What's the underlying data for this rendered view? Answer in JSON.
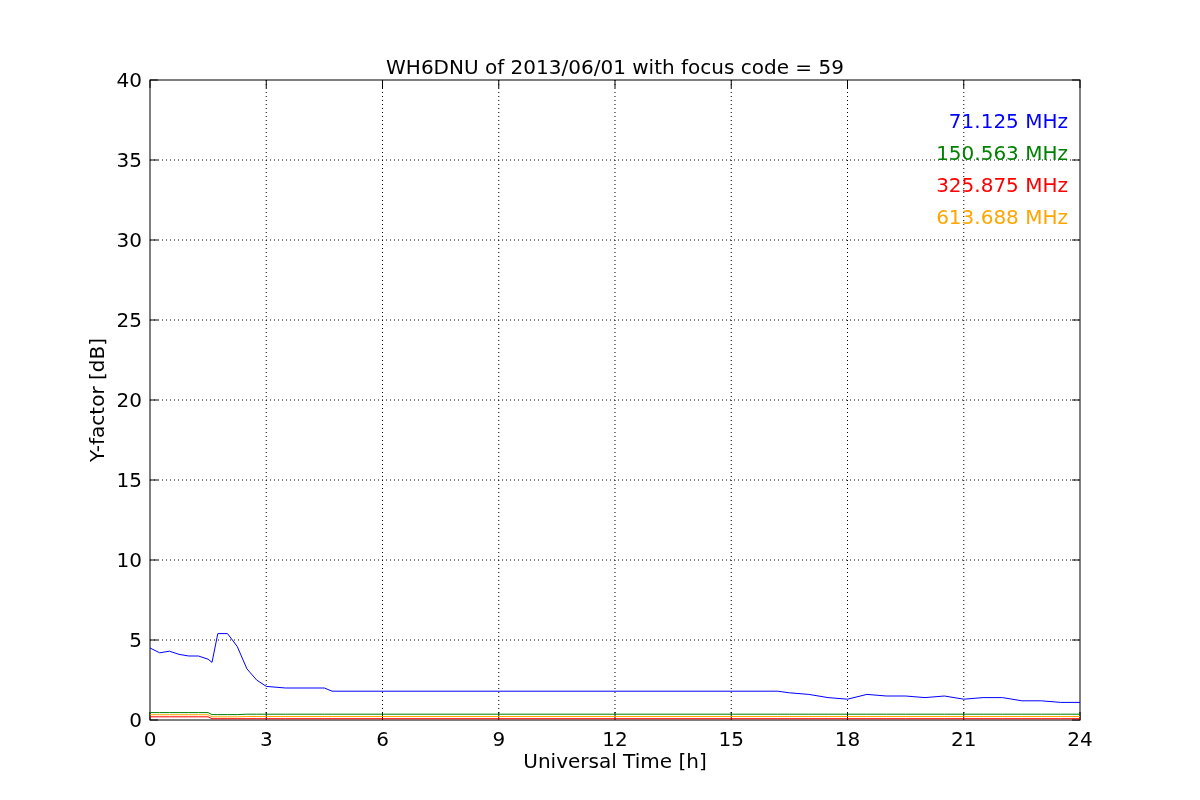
{
  "chart_data": {
    "type": "line",
    "title": "WH6DNU of 2013/06/01 with focus code = 59",
    "xlabel": "Universal Time [h]",
    "ylabel": "Y-factor [dB]",
    "x": [
      0,
      0.25,
      0.5,
      0.75,
      1,
      1.25,
      1.5,
      1.6,
      1.75,
      2,
      2.25,
      2.5,
      2.75,
      3,
      3.5,
      4,
      4.5,
      4.7,
      16.2,
      16.5,
      17,
      17.5,
      18,
      18.5,
      19,
      19.5,
      20,
      20.5,
      21,
      21.5,
      22,
      22.5,
      23,
      23.5,
      24
    ],
    "series": [
      {
        "name": "71.125 MHz",
        "color": "#0000ff",
        "values": [
          4.5,
          4.2,
          4.3,
          4.1,
          4.0,
          4.0,
          3.8,
          3.6,
          5.4,
          5.4,
          4.6,
          3.2,
          2.5,
          2.1,
          2.0,
          2.0,
          2.0,
          1.8,
          1.8,
          1.7,
          1.6,
          1.4,
          1.3,
          1.6,
          1.5,
          1.5,
          1.4,
          1.5,
          1.3,
          1.4,
          1.4,
          1.2,
          1.2,
          1.1,
          1.1
        ]
      },
      {
        "name": "150.563 MHz",
        "color": "#008000",
        "values": [
          0.46,
          0.46,
          0.46,
          0.46,
          0.46,
          0.46,
          0.46,
          0.34,
          0.34,
          0.34,
          0.34,
          0.36,
          0.36,
          0.36,
          0.36,
          0.36,
          0.36,
          0.36,
          0.36,
          0.36,
          0.36,
          0.36,
          0.36,
          0.36,
          0.36,
          0.36,
          0.36,
          0.36,
          0.36,
          0.36,
          0.36,
          0.36,
          0.36,
          0.36,
          0.36
        ]
      },
      {
        "name": "325.875 MHz",
        "color": "#ff0000",
        "values": [
          0.2,
          0.2,
          0.2,
          0.2,
          0.2,
          0.2,
          0.2,
          0.08,
          0.08,
          0.08,
          0.08,
          0.08,
          0.08,
          0.08,
          0.08,
          0.08,
          0.08,
          0.08,
          0.08,
          0.08,
          0.08,
          0.08,
          0.08,
          0.08,
          0.08,
          0.08,
          0.08,
          0.08,
          0.08,
          0.08,
          0.08,
          0.08,
          0.08,
          0.08,
          0.08
        ]
      },
      {
        "name": "613.688 MHz",
        "color": "#ffa500",
        "values": [
          0.33,
          0.33,
          0.33,
          0.33,
          0.33,
          0.33,
          0.33,
          0.2,
          0.2,
          0.2,
          0.2,
          0.22,
          0.22,
          0.22,
          0.22,
          0.22,
          0.22,
          0.22,
          0.22,
          0.22,
          0.22,
          0.22,
          0.22,
          0.22,
          0.22,
          0.22,
          0.22,
          0.22,
          0.22,
          0.22,
          0.22,
          0.22,
          0.22,
          0.22,
          0.22
        ]
      }
    ],
    "grid": true,
    "xlim": [
      0,
      24
    ],
    "ylim": [
      0,
      40
    ],
    "xticks": [
      0,
      3,
      6,
      9,
      12,
      15,
      18,
      21,
      24
    ],
    "yticks": [
      0,
      5,
      10,
      15,
      20,
      25,
      30,
      35,
      40
    ]
  }
}
